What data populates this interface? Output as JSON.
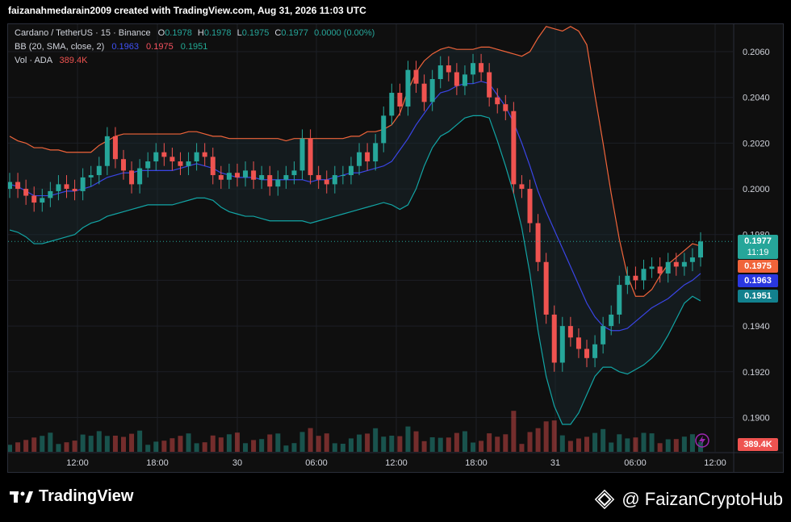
{
  "header": {
    "caption": "faizanahmedarain2009 created with TradingView.com, Aug 31, 2026 11:03 UTC"
  },
  "legend": {
    "symbol": "Cardano / TetherUS · 15 · Binance",
    "o_label": "O",
    "o_value": "0.1978",
    "h_label": "H",
    "h_value": "0.1978",
    "l_label": "L",
    "l_value": "0.1975",
    "c_label": "C",
    "c_value": "0.1977",
    "change": "0.0000 (0.00%)",
    "bb_label": "BB (20, SMA, close, 2)",
    "bb_basis": "0.1963",
    "bb_upper": "0.1975",
    "bb_lower": "0.1951",
    "vol_label": "Vol · ADA",
    "vol_value": "389.4K"
  },
  "price_tags": {
    "last_price": "0.1977",
    "countdown": "11:19",
    "bb_upper": "0.1975",
    "bb_basis": "0.1963",
    "bb_lower": "0.1951",
    "volume": "389.4K"
  },
  "footer": {
    "brand": "TradingView",
    "watermark": "@ FaizanCryptoHub"
  },
  "colors": {
    "up": "#26a69a",
    "down": "#ef5350",
    "basis": "#2962ff",
    "upper": "#f7525f",
    "lower": "#22ab94",
    "background": "#0f0f0f",
    "grid": "#1c1f26"
  },
  "chart_data": {
    "type": "candlestick",
    "y_ticks": [
      "0.2060",
      "0.2040",
      "0.2020",
      "0.2000",
      "0.1980",
      "0.1960",
      "0.1940",
      "0.1920",
      "0.1900"
    ],
    "x_ticks": [
      "12:00",
      "18:00",
      "30",
      "06:00",
      "12:00",
      "18:00",
      "31",
      "06:00",
      "12:00"
    ],
    "ylim": [
      0.1885,
      0.2072
    ],
    "last_price": 0.1977,
    "grid": true,
    "bb_upper_path": [
      0.2023,
      0.2021,
      0.202,
      0.2018,
      0.2018,
      0.2017,
      0.2017,
      0.2016,
      0.2016,
      0.2016,
      0.2016,
      0.2019,
      0.2021,
      0.2023,
      0.2024,
      0.2024,
      0.2024,
      0.2024,
      0.2024,
      0.2024,
      0.2024,
      0.2024,
      0.2025,
      0.2025,
      0.2024,
      0.2023,
      0.2023,
      0.2022,
      0.2022,
      0.2022,
      0.2022,
      0.2022,
      0.2022,
      0.2022,
      0.2021,
      0.2022,
      0.2022,
      0.2022,
      0.2022,
      0.2022,
      0.2022,
      0.2022,
      0.2023,
      0.2023,
      0.2025,
      0.2025,
      0.2026,
      0.2028,
      0.2033,
      0.2043,
      0.2051,
      0.2056,
      0.2059,
      0.2061,
      0.2062,
      0.2061,
      0.2061,
      0.2061,
      0.2062,
      0.2062,
      0.2061,
      0.206,
      0.2059,
      0.2058,
      0.206,
      0.2066,
      0.2071,
      0.207,
      0.2069,
      0.2071,
      0.2069,
      0.2063,
      0.2041,
      0.202,
      0.1998,
      0.1978,
      0.1962,
      0.1953,
      0.1953,
      0.1956,
      0.1962,
      0.1967,
      0.197,
      0.1973,
      0.1976,
      0.1975
    ],
    "bb_basis_path": [
      0.2002,
      0.2001,
      0.1999,
      0.1997,
      0.1997,
      0.1997,
      0.1998,
      0.1999,
      0.1999,
      0.2,
      0.2001,
      0.2003,
      0.2005,
      0.2006,
      0.2007,
      0.2007,
      0.2008,
      0.2008,
      0.2008,
      0.2008,
      0.2008,
      0.2009,
      0.201,
      0.2011,
      0.201,
      0.2009,
      0.2007,
      0.2006,
      0.2005,
      0.2005,
      0.2005,
      0.2004,
      0.2004,
      0.2004,
      0.2004,
      0.2004,
      0.2004,
      0.2003,
      0.2004,
      0.2004,
      0.2005,
      0.2006,
      0.2007,
      0.2007,
      0.2008,
      0.2009,
      0.201,
      0.2012,
      0.2017,
      0.2022,
      0.2028,
      0.2033,
      0.2038,
      0.2042,
      0.2043,
      0.2045,
      0.2046,
      0.2046,
      0.2047,
      0.2046,
      0.2041,
      0.2036,
      0.2029,
      0.202,
      0.201,
      0.1999,
      0.199,
      0.1982,
      0.1974,
      0.1966,
      0.1958,
      0.195,
      0.1944,
      0.194,
      0.1938,
      0.1938,
      0.1939,
      0.1942,
      0.1945,
      0.1948,
      0.195,
      0.1952,
      0.1955,
      0.1958,
      0.196,
      0.1963
    ],
    "bb_lower_path": [
      0.1982,
      0.1981,
      0.1979,
      0.1976,
      0.1976,
      0.1977,
      0.1978,
      0.1979,
      0.198,
      0.1983,
      0.1985,
      0.1986,
      0.1988,
      0.1989,
      0.199,
      0.1991,
      0.1992,
      0.1993,
      0.1993,
      0.1993,
      0.1993,
      0.1994,
      0.1995,
      0.1996,
      0.1996,
      0.1995,
      0.1992,
      0.199,
      0.1989,
      0.1988,
      0.1988,
      0.1987,
      0.1986,
      0.1986,
      0.1986,
      0.1986,
      0.1986,
      0.1985,
      0.1986,
      0.1987,
      0.1988,
      0.1989,
      0.199,
      0.1991,
      0.1992,
      0.1993,
      0.1994,
      0.1993,
      0.1991,
      0.1993,
      0.2,
      0.201,
      0.2018,
      0.2023,
      0.2025,
      0.2028,
      0.2031,
      0.2032,
      0.2032,
      0.2031,
      0.2021,
      0.201,
      0.1998,
      0.1983,
      0.1963,
      0.1938,
      0.1918,
      0.1905,
      0.1897,
      0.1897,
      0.1902,
      0.191,
      0.1918,
      0.1922,
      0.1922,
      0.192,
      0.1919,
      0.1921,
      0.1923,
      0.1926,
      0.193,
      0.1936,
      0.1943,
      0.195,
      0.1953,
      0.1951
    ],
    "candles_close": [
      0.2003,
      0.2,
      0.1997,
      0.1994,
      0.1996,
      0.1999,
      0.2002,
      0.2,
      0.1999,
      0.2005,
      0.2006,
      0.201,
      0.2023,
      0.2013,
      0.2008,
      0.2002,
      0.2009,
      0.2012,
      0.2016,
      0.2014,
      0.2012,
      0.201,
      0.2012,
      0.2016,
      0.2014,
      0.2006,
      0.2004,
      0.2007,
      0.2005,
      0.2008,
      0.2004,
      0.2006,
      0.2001,
      0.2004,
      0.2006,
      0.2008,
      0.2022,
      0.2006,
      0.2004,
      0.2002,
      0.2006,
      0.2006,
      0.201,
      0.2016,
      0.2012,
      0.202,
      0.2032,
      0.2042,
      0.2036,
      0.2052,
      0.2046,
      0.2038,
      0.2048,
      0.2054,
      0.2051,
      0.2045,
      0.205,
      0.2055,
      0.2051,
      0.204,
      0.2037,
      0.2034,
      0.2002,
      0.2,
      0.1985,
      0.1968,
      0.1945,
      0.1924,
      0.194,
      0.1935,
      0.193,
      0.1926,
      0.1932,
      0.194,
      0.1945,
      0.1958,
      0.1962,
      0.196,
      0.1965,
      0.1966,
      0.1963,
      0.1968,
      0.1966,
      0.1968,
      0.197,
      0.1977
    ],
    "volume_last": "389.4K"
  }
}
